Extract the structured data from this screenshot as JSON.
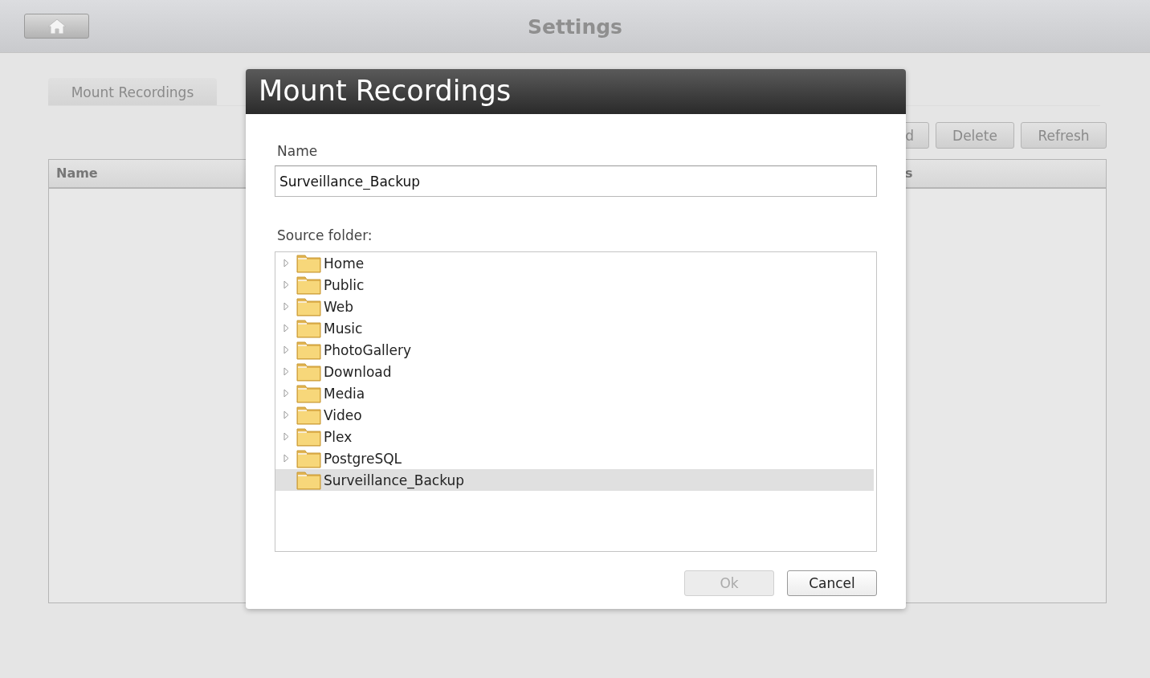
{
  "header": {
    "title": "Settings"
  },
  "tabs": [
    {
      "label": "Mount Recordings",
      "selected": true
    }
  ],
  "toolbar": {
    "buttons": [
      "d",
      "Delete",
      "Refresh"
    ]
  },
  "table": {
    "columns": [
      "Name",
      "s"
    ]
  },
  "dialog": {
    "title": "Mount Recordings",
    "name_label": "Name",
    "name_value": "Surveillance_Backup",
    "folder_label": "Source folder:",
    "folders": [
      {
        "label": "Home",
        "expandable": true,
        "selected": false
      },
      {
        "label": "Public",
        "expandable": true,
        "selected": false
      },
      {
        "label": "Web",
        "expandable": true,
        "selected": false
      },
      {
        "label": "Music",
        "expandable": true,
        "selected": false
      },
      {
        "label": "PhotoGallery",
        "expandable": true,
        "selected": false
      },
      {
        "label": "Download",
        "expandable": true,
        "selected": false
      },
      {
        "label": "Media",
        "expandable": true,
        "selected": false
      },
      {
        "label": "Video",
        "expandable": true,
        "selected": false
      },
      {
        "label": "Plex",
        "expandable": true,
        "selected": false
      },
      {
        "label": "PostgreSQL",
        "expandable": true,
        "selected": false
      },
      {
        "label": "Surveillance_Backup",
        "expandable": false,
        "selected": true
      }
    ],
    "buttons": [
      {
        "label": "Ok",
        "disabled": true
      },
      {
        "label": "Cancel",
        "disabled": false
      }
    ]
  }
}
